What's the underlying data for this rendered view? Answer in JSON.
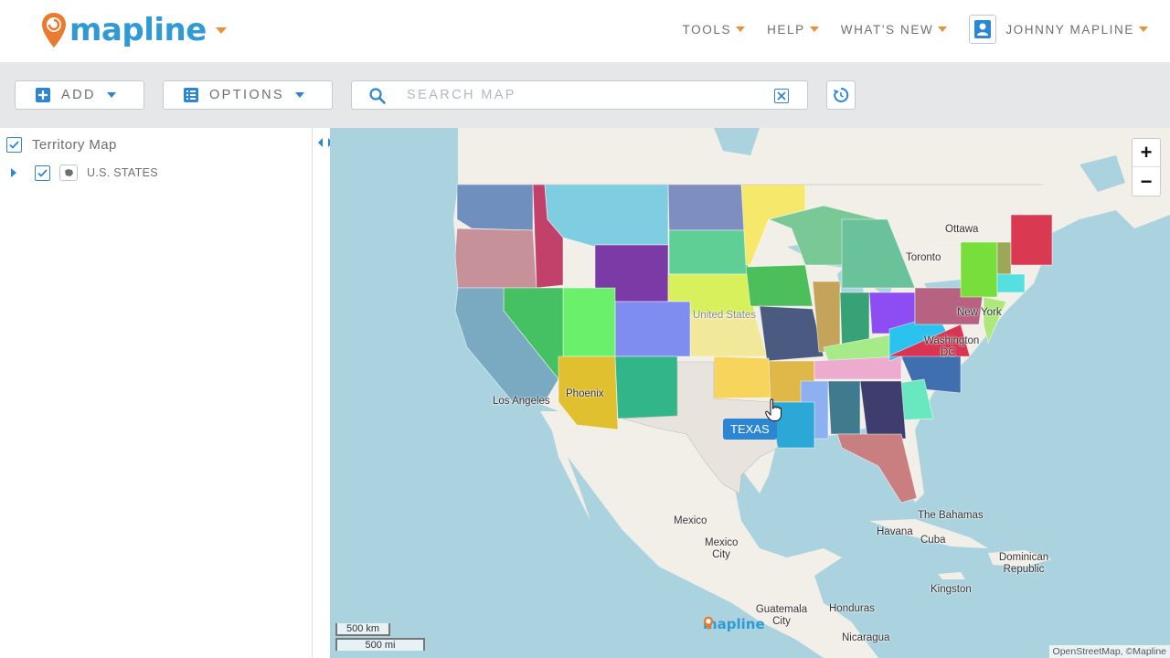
{
  "header": {
    "brand": "mapline",
    "nav": [
      {
        "label": "TOOLS"
      },
      {
        "label": "HELP"
      },
      {
        "label": "WHAT'S NEW"
      }
    ],
    "user_name": "JOHNNY MAPLINE"
  },
  "toolbar": {
    "add_label": "ADD",
    "options_label": "OPTIONS",
    "search_placeholder": "SEARCH MAP",
    "search_value": ""
  },
  "sidebar": {
    "root_label": "Territory Map",
    "root_checked": true,
    "layers": [
      {
        "label": "U.S. STATES",
        "checked": true
      }
    ]
  },
  "map": {
    "tooltip": "TEXAS",
    "zoom_in": "+",
    "zoom_out": "−",
    "scale_km": "500 km",
    "scale_mi": "500 mi",
    "attribution": "OpenStreetMap, ©Mapline",
    "watermark": "mapline",
    "place_labels": {
      "ottawa": "Ottawa",
      "toronto": "Toronto",
      "new_york": "New York",
      "washington": "Washington",
      "dc": "DC",
      "los_angeles": "Los Angeles",
      "phoenix": "Phoenix",
      "united_states": "United States",
      "mexico": "Mexico",
      "mexico_city": "Mexico City",
      "havana": "Havana",
      "cuba": "Cuba",
      "the_bahamas": "The Bahamas",
      "dominican_republic": "Dominican Republic",
      "kingston": "Kingston",
      "guatemala_city": "Guatemala City",
      "honduras": "Honduras",
      "nicaragua": "Nicaragua"
    }
  },
  "colors": {
    "brand_blue": "#2f9ad6",
    "accent_orange": "#e8913a",
    "ui_blue": "#2d86d3",
    "toolbar_gray": "#e6e7e9",
    "water": "#aad3df",
    "land": "#f2efe9"
  }
}
